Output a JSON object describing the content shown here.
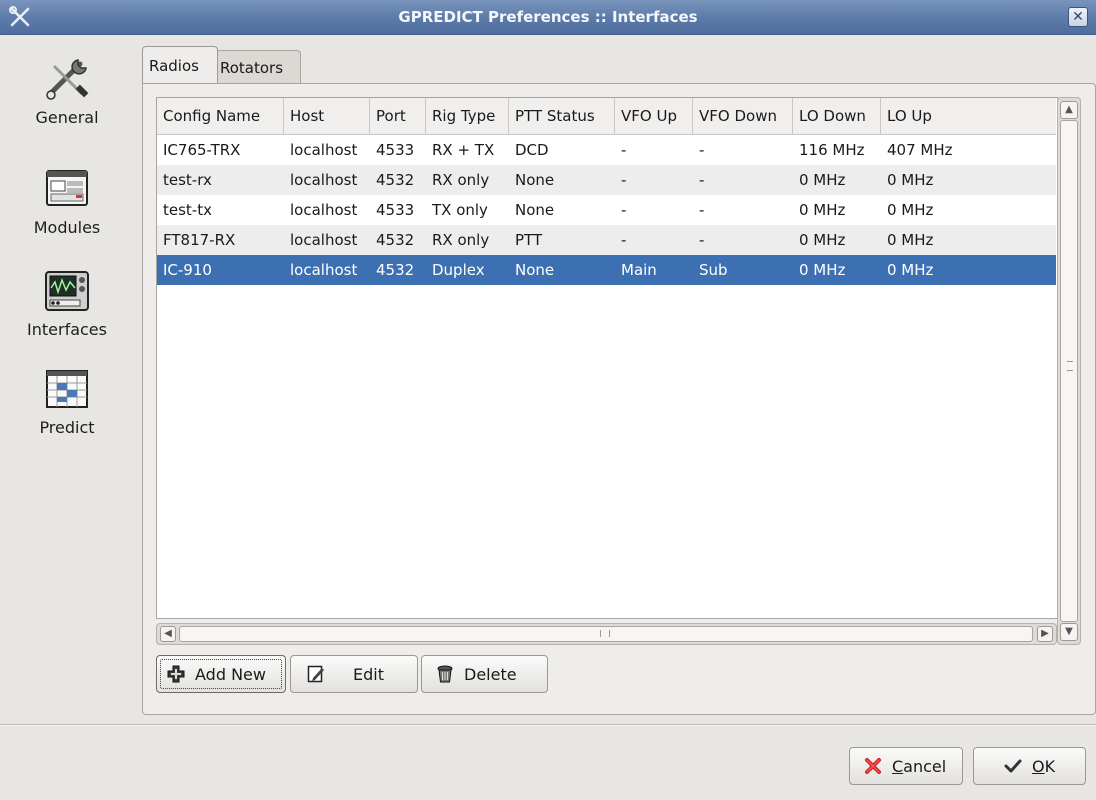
{
  "window": {
    "title": "GPREDICT Preferences :: Interfaces"
  },
  "sidebar": {
    "items": [
      {
        "label": "General",
        "icon": "wrench-screwdriver-icon"
      },
      {
        "label": "Modules",
        "icon": "modules-window-icon"
      },
      {
        "label": "Interfaces",
        "icon": "radio-scope-icon"
      },
      {
        "label": "Predict",
        "icon": "predict-grid-icon"
      }
    ],
    "selected": "Interfaces"
  },
  "tabs": [
    {
      "label": "Radios",
      "active": true
    },
    {
      "label": "Rotators",
      "active": false
    }
  ],
  "table": {
    "columns": [
      "Config Name",
      "Host",
      "Port",
      "Rig Type",
      "PTT Status",
      "VFO Up",
      "VFO Down",
      "LO Down",
      "LO Up"
    ],
    "rows": [
      [
        "IC765-TRX",
        "localhost",
        "4533",
        "RX + TX",
        "DCD",
        "-",
        "-",
        "116 MHz",
        "407 MHz"
      ],
      [
        "test-rx",
        "localhost",
        "4532",
        "RX only",
        "None",
        "-",
        "-",
        "0 MHz",
        "0 MHz"
      ],
      [
        "test-tx",
        "localhost",
        "4533",
        "TX only",
        "None",
        "-",
        "-",
        "0 MHz",
        "0 MHz"
      ],
      [
        "FT817-RX",
        "localhost",
        "4532",
        "RX only",
        "PTT",
        "-",
        "-",
        "0 MHz",
        "0 MHz"
      ],
      [
        "IC-910",
        "localhost",
        "4532",
        "Duplex",
        "None",
        "Main",
        "Sub",
        "0 MHz",
        "0 MHz"
      ]
    ],
    "selected_row": 4
  },
  "buttons": {
    "add_new": "Add New",
    "edit": "Edit",
    "delete": "Delete",
    "cancel_prefix": "",
    "cancel_mnemonic": "C",
    "cancel_rest": "ancel",
    "ok_mnemonic": "O",
    "ok_rest": "K"
  },
  "colors": {
    "titlebar": "#5b7aa8",
    "selection": "#3d70b2"
  }
}
